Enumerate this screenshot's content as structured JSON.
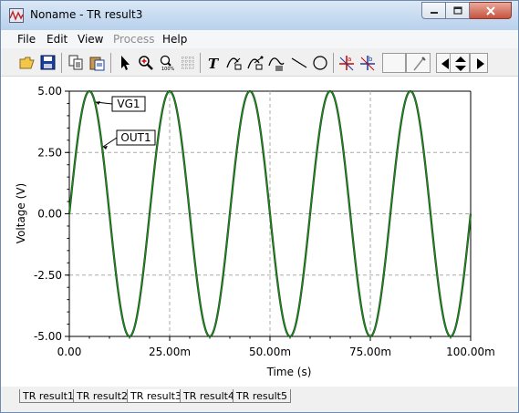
{
  "window": {
    "title": "Noname - TR result3",
    "icon": "oscilloscope-app-icon"
  },
  "menu": [
    "File",
    "Edit",
    "View",
    "Process",
    "Help"
  ],
  "menu_disabled": [
    "Process"
  ],
  "toolbar": {
    "buttons": [
      "open-file-icon",
      "save-icon",
      "copy-icon",
      "paste-icon",
      "pointer-icon",
      "zoom-in-icon",
      "zoom-fit-icon",
      "grid-icon",
      "text-tool-icon",
      "annotate-curve-icon",
      "annotate-point-icon",
      "annotate-trace-icon",
      "line-icon",
      "ellipse-icon",
      "cursor-a-icon",
      "cursor-b-icon",
      "probe-icon",
      "arrow-left-icon",
      "arrow-updown-icon",
      "arrow-right-icon"
    ]
  },
  "colors": {
    "trace_vg1": "#1a1a1a",
    "trace_out1": "#1a8a1a",
    "grid": "#aaaaaa"
  },
  "chart_data": {
    "type": "line",
    "xlabel": "Time (s)",
    "ylabel": "Voltage (V)",
    "xlim": [
      0,
      0.1
    ],
    "ylim": [
      -5,
      5
    ],
    "x_tick_labels": [
      "0.00",
      "25.00m",
      "50.00m",
      "75.00m",
      "100.00m"
    ],
    "y_tick_labels": [
      "5.00",
      "2.50",
      "0.00",
      "-2.50",
      "-5.00"
    ],
    "grid": true,
    "series": [
      {
        "name": "VG1",
        "amplitude": 5,
        "frequency_hz": 50,
        "phase_deg": 0
      },
      {
        "name": "OUT1",
        "amplitude": 5,
        "frequency_hz": 50,
        "phase_deg": 0
      }
    ]
  },
  "tabs": [
    "TR result1",
    "TR result2",
    "TR result3",
    "TR result4",
    "TR result5"
  ],
  "active_tab": "TR result3"
}
